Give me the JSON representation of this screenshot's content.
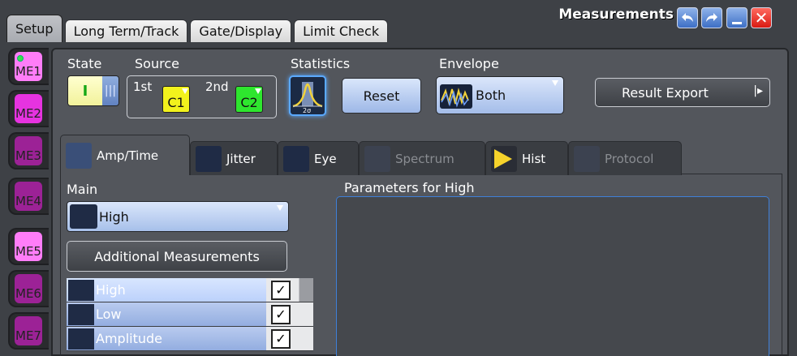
{
  "window": {
    "title": "Measurements"
  },
  "top_tabs": [
    "Setup",
    "Long Term/Track",
    "Gate/Display",
    "Limit Check"
  ],
  "me_tabs": [
    {
      "label": "ME1",
      "color": "#ff7df8"
    },
    {
      "label": "ME2",
      "color": "#e633e0"
    },
    {
      "label": "ME3",
      "color": "#9c2296"
    },
    {
      "label": "ME4",
      "color": "#9c2296"
    },
    {
      "label": "ME5",
      "color": "#ff7df8"
    },
    {
      "label": "ME6",
      "color": "#9c2296"
    },
    {
      "label": "ME7",
      "color": "#9c2296"
    }
  ],
  "controls": {
    "state_label": "State",
    "state_on": "I",
    "state_off": "|||",
    "source_label": "Source",
    "first_label": "1st",
    "first_value": "C1",
    "second_label": "2nd",
    "second_value": "C2",
    "statistics_label": "Statistics",
    "statistics_icon_text": "2σ",
    "reset_label": "Reset",
    "envelope_label": "Envelope",
    "envelope_value": "Both",
    "export_label": "Result Export"
  },
  "sub_tabs": [
    {
      "label": "Amp/Time",
      "active": true,
      "enabled": true
    },
    {
      "label": "Jitter",
      "active": false,
      "enabled": true
    },
    {
      "label": "Eye",
      "active": false,
      "enabled": true
    },
    {
      "label": "Spectrum",
      "active": false,
      "enabled": false
    },
    {
      "label": "Hist",
      "active": false,
      "enabled": true
    },
    {
      "label": "Protocol",
      "active": false,
      "enabled": false
    }
  ],
  "amp_time": {
    "main_label": "Main",
    "main_value": "High",
    "additional_label": "Additional Measurements",
    "params_label": "Parameters for High",
    "list": [
      {
        "name": "High",
        "checked": true,
        "selected": true
      },
      {
        "name": "Low",
        "checked": true,
        "selected": false
      },
      {
        "name": "Amplitude",
        "checked": true,
        "selected": false
      }
    ]
  }
}
